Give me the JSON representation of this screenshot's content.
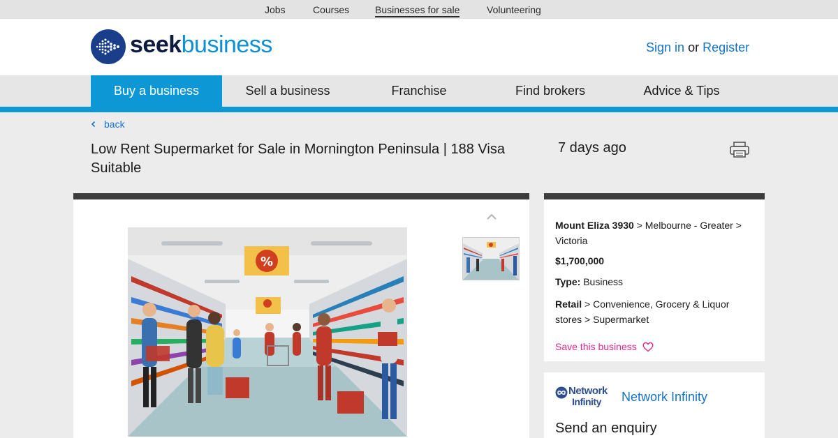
{
  "topnav": {
    "items": [
      "Jobs",
      "Courses",
      "Businesses for sale",
      "Volunteering"
    ],
    "active": "Businesses for sale"
  },
  "header": {
    "logo_primary": "seek",
    "logo_secondary": "business",
    "sign_in": "Sign in",
    "or": "or",
    "register": "Register",
    "brand_color": "#0d97d4"
  },
  "mainnav": {
    "items": [
      "Buy a business",
      "Sell a business",
      "Franchise",
      "Find brokers",
      "Advice & Tips"
    ],
    "active": "Buy a business"
  },
  "listing": {
    "back": "back",
    "title": "Low Rent Supermarket for Sale in Mornington Peninsula | 188 Visa Suitable",
    "age": "7 days ago",
    "photo_count_shown": 1
  },
  "details": {
    "location_bold": "Mount Eliza 3930",
    "location_rest": "> Melbourne - Greater > Victoria",
    "price": "$1,700,000",
    "type_label": "Type:",
    "type_value": "Business",
    "category_bold": "Retail",
    "category_rest": "> Convenience, Grocery & Liquor stores > Supermarket",
    "save": "Save this business"
  },
  "broker": {
    "logo_line1": "Network",
    "logo_line2": "Infinity",
    "name": "Network Infinity",
    "enquiry": "Send an enquiry"
  },
  "colors": {
    "accent": "#0d97d4",
    "link": "#1473c6",
    "save": "#e0288c",
    "panel_border": "#3c3c3c"
  }
}
